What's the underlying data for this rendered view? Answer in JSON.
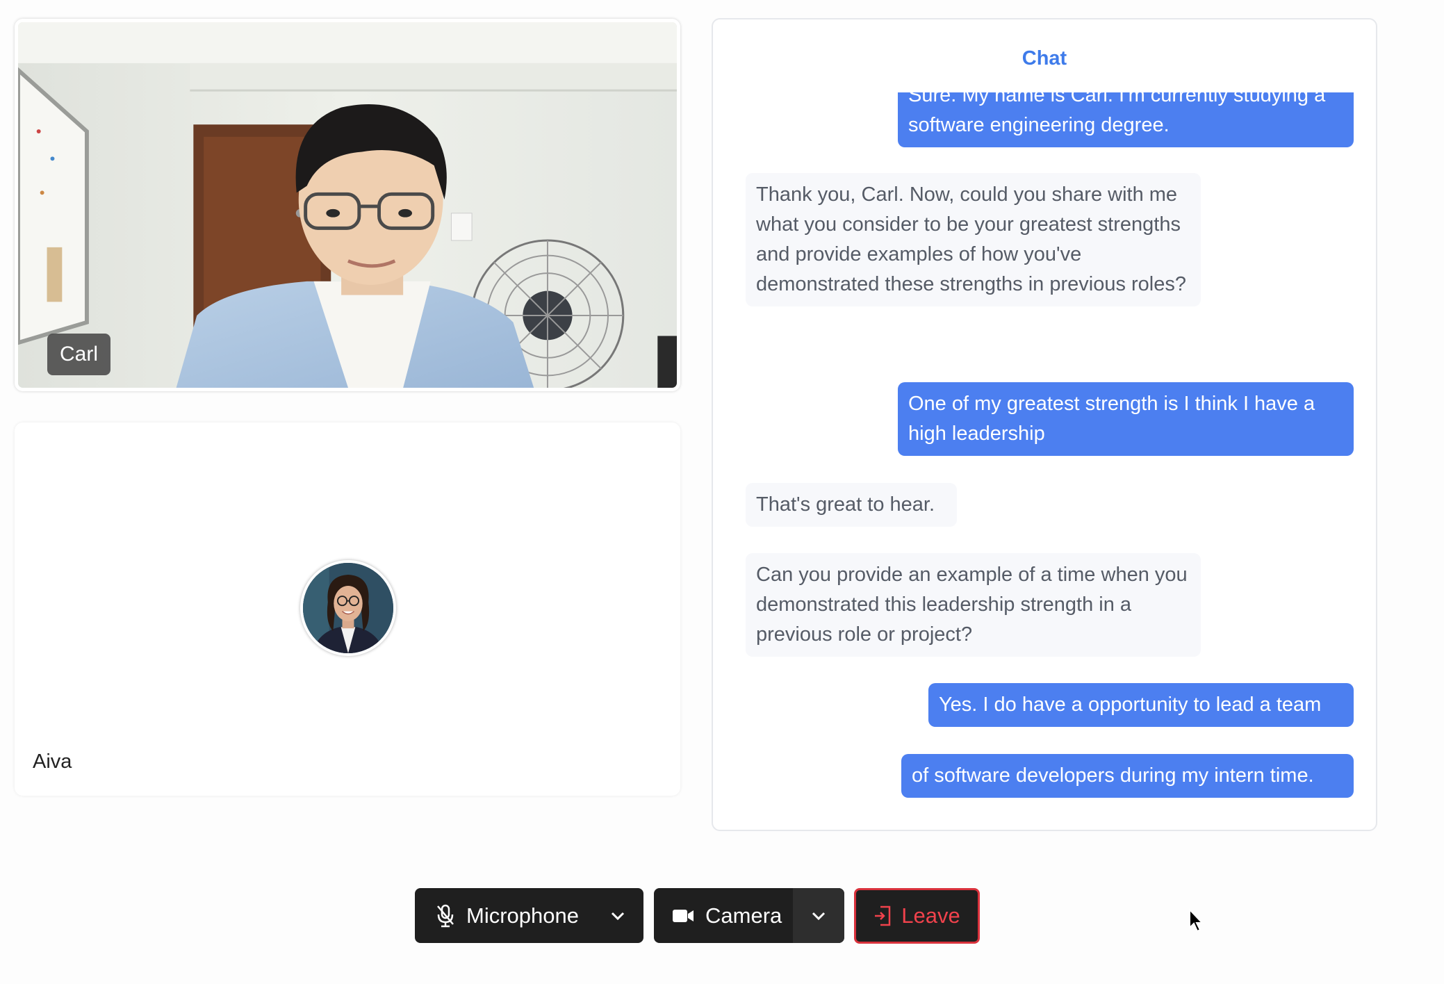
{
  "participants": {
    "user": {
      "name": "Carl"
    },
    "assistant": {
      "name": "Aiva"
    }
  },
  "chat": {
    "title": "Chat",
    "messages": [
      {
        "role": "user",
        "text": "Sure. My name is Carl. I'm currently studying a software engineering degree."
      },
      {
        "role": "bot",
        "text": "Thank you, Carl. Now, could you share with me what you consider to be your greatest strengths and provide examples of how you've demonstrated these strengths in previous roles?"
      },
      {
        "role": "user",
        "text": "One of my greatest strength is I think I have a high leadership"
      },
      {
        "role": "bot",
        "text": "That's great to hear."
      },
      {
        "role": "bot",
        "text": "Can you provide an example of a time when you demonstrated this leadership strength in a previous role or project?"
      },
      {
        "role": "user",
        "text": "Yes. I do have a opportunity to lead a team"
      },
      {
        "role": "user",
        "text": "of software developers during my intern time."
      }
    ]
  },
  "controls": {
    "microphone": {
      "label": "Microphone",
      "icon": "mic-off-icon"
    },
    "camera": {
      "label": "Camera",
      "icon": "video-camera-icon"
    },
    "leave": {
      "label": "Leave",
      "icon": "exit-icon"
    }
  },
  "colors": {
    "accent": "#4c7ff0",
    "chat_title": "#3e7bea",
    "leave": "#f0424c",
    "control_bg": "#1f1f1f"
  }
}
